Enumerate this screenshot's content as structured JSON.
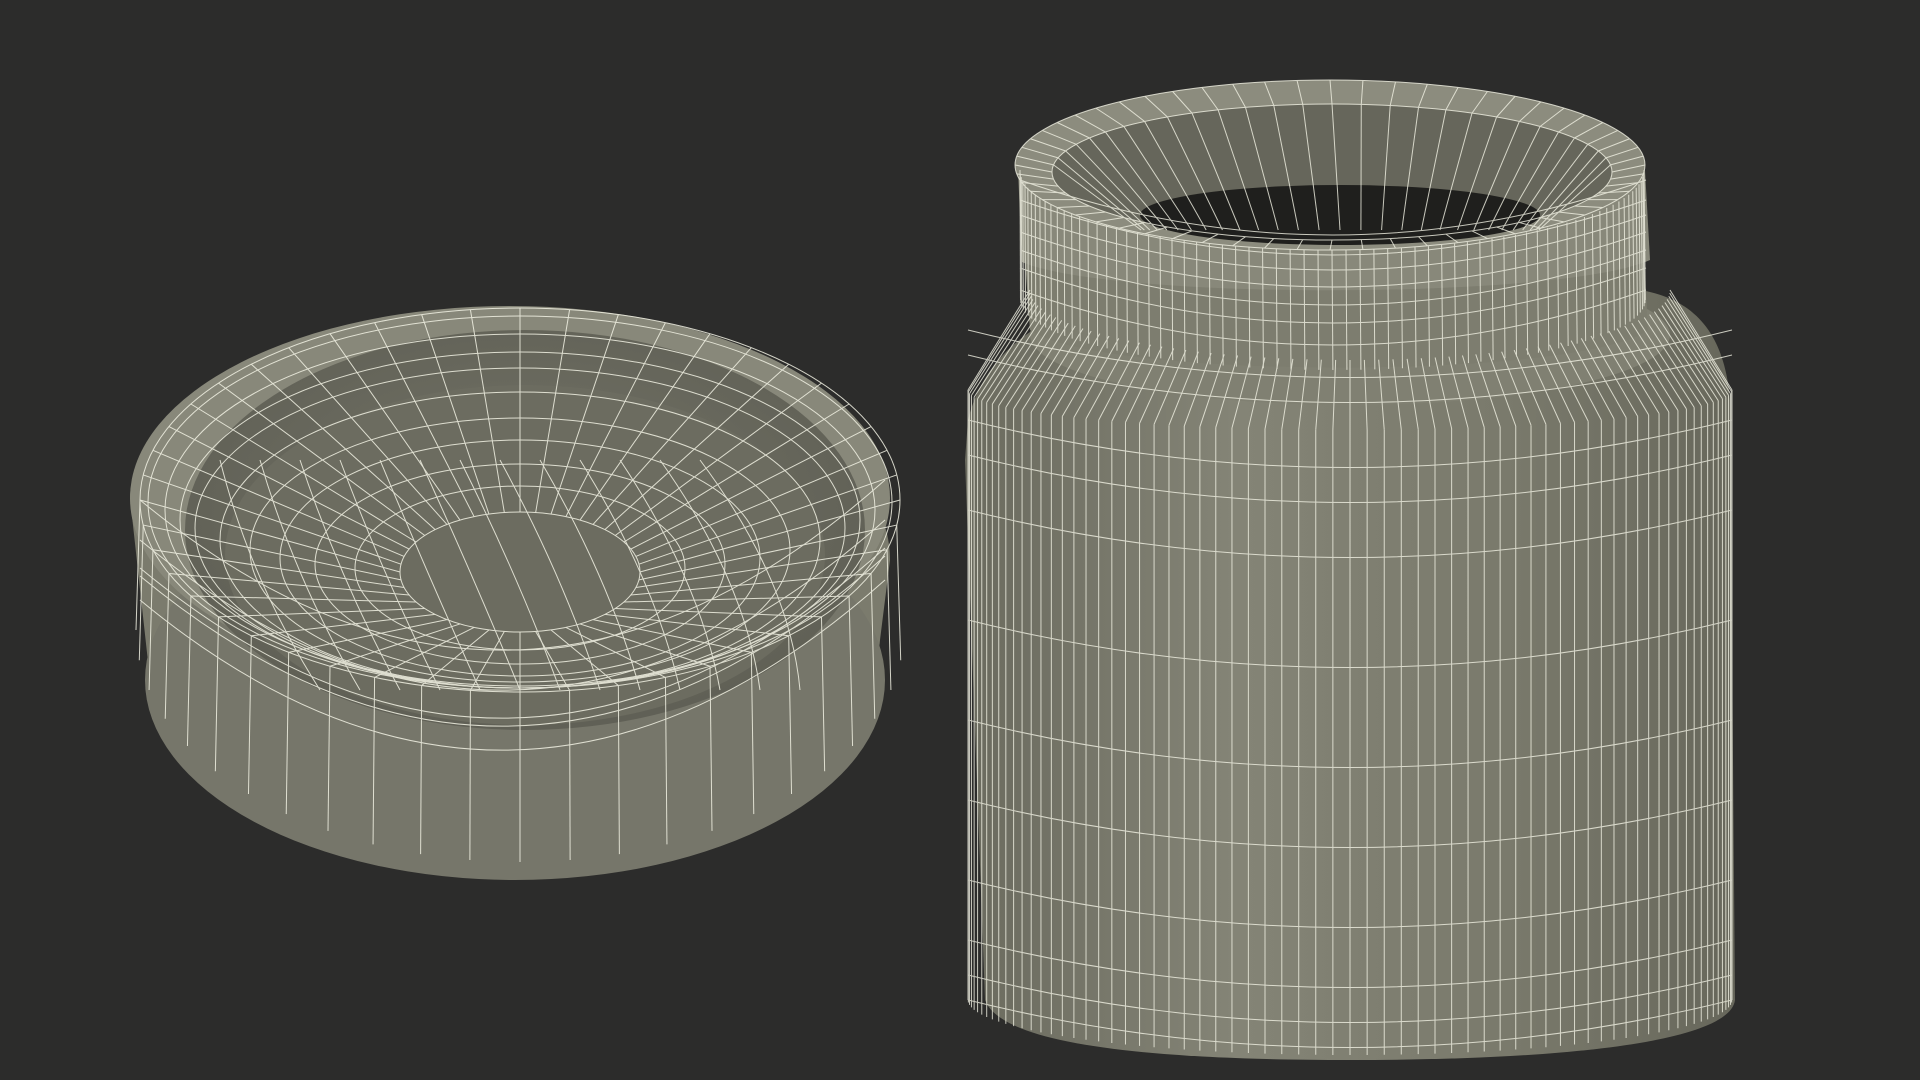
{
  "scene": {
    "background": "#2c2c2b",
    "mesh_fill": "#7a7a6c",
    "mesh_fill_dark": "#5f5f55",
    "mesh_fill_light": "#8e8e80",
    "wire_color": "#f2f2e4",
    "objects": [
      {
        "name": "jar-lid",
        "kind": "lid"
      },
      {
        "name": "jar-body",
        "kind": "jar"
      }
    ]
  }
}
